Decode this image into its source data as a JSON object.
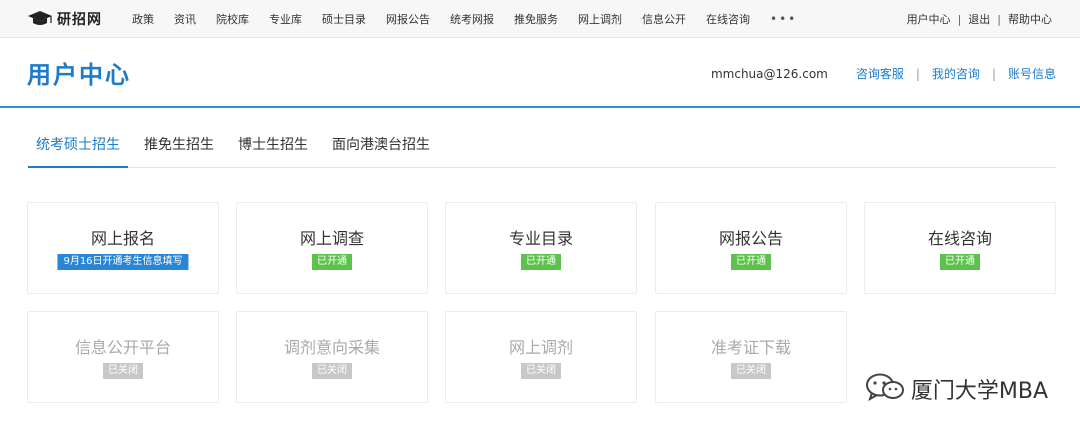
{
  "topnav": {
    "logo_text": "研招网",
    "items": [
      "政策",
      "资讯",
      "院校库",
      "专业库",
      "硕士目录",
      "网报公告",
      "统考网报",
      "推免服务",
      "网上调剂",
      "信息公开",
      "在线咨询"
    ],
    "more": "•••",
    "right": [
      "用户中心",
      "退出",
      "帮助中心"
    ],
    "separator": "|"
  },
  "header": {
    "title": "用户中心",
    "email": "mmchua@126.com",
    "links": [
      "咨询客服",
      "我的咨询",
      "账号信息"
    ],
    "separator": "|"
  },
  "tabs": [
    "统考硕士招生",
    "推免生招生",
    "博士生招生",
    "面向港澳台招生"
  ],
  "cards": [
    {
      "title": "网上报名",
      "badge": "9月16日开通考生信息填写"
    },
    {
      "title": "网上调查",
      "badge": "已开通"
    },
    {
      "title": "专业目录",
      "badge": "已开通"
    },
    {
      "title": "网报公告",
      "badge": "已开通"
    },
    {
      "title": "在线咨询",
      "badge": "已开通"
    },
    {
      "title": "信息公开平台",
      "badge": "已关闭"
    },
    {
      "title": "调剂意向采集",
      "badge": "已关闭"
    },
    {
      "title": "网上调剂",
      "badge": "已关闭"
    },
    {
      "title": "准考证下载",
      "badge": "已关闭"
    }
  ],
  "watermark": {
    "text": "厦门大学MBA",
    "icon": "wechat-icon"
  },
  "colors": {
    "accent": "#1e7bc8",
    "open": "#5cc24c",
    "closed": "#c8c8c8",
    "notice": "#2a86d5"
  }
}
